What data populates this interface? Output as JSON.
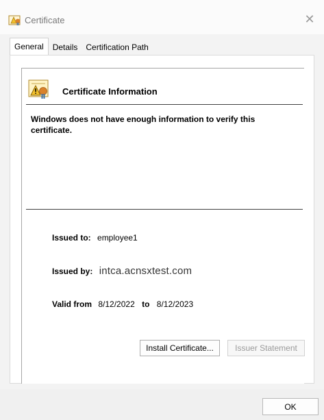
{
  "window": {
    "title": "Certificate",
    "close_glyph": "✕",
    "icon": "certificate-icon"
  },
  "tabs": [
    {
      "label": "General",
      "active": true
    },
    {
      "label": "Details",
      "active": false
    },
    {
      "label": "Certification Path",
      "active": false
    }
  ],
  "general": {
    "heading": "Certificate Information",
    "warning": "Windows does not have enough information to verify this certificate.",
    "issued_to_label": "Issued to:",
    "issued_to_value": "employee1",
    "issued_by_label": "Issued by:",
    "issued_by_value": "intca.acnsxtest.com",
    "valid_from_label": "Valid from",
    "valid_from_value": "8/12/2022",
    "valid_to_label": "to",
    "valid_to_value": "8/12/2023"
  },
  "buttons": {
    "install": "Install Certificate...",
    "issuer_statement": "Issuer Statement",
    "ok": "OK"
  },
  "colors": {
    "warning_yellow": "#f2c12e",
    "seal_orange": "#d9822b",
    "ribbon_blue": "#3a6ea5"
  }
}
